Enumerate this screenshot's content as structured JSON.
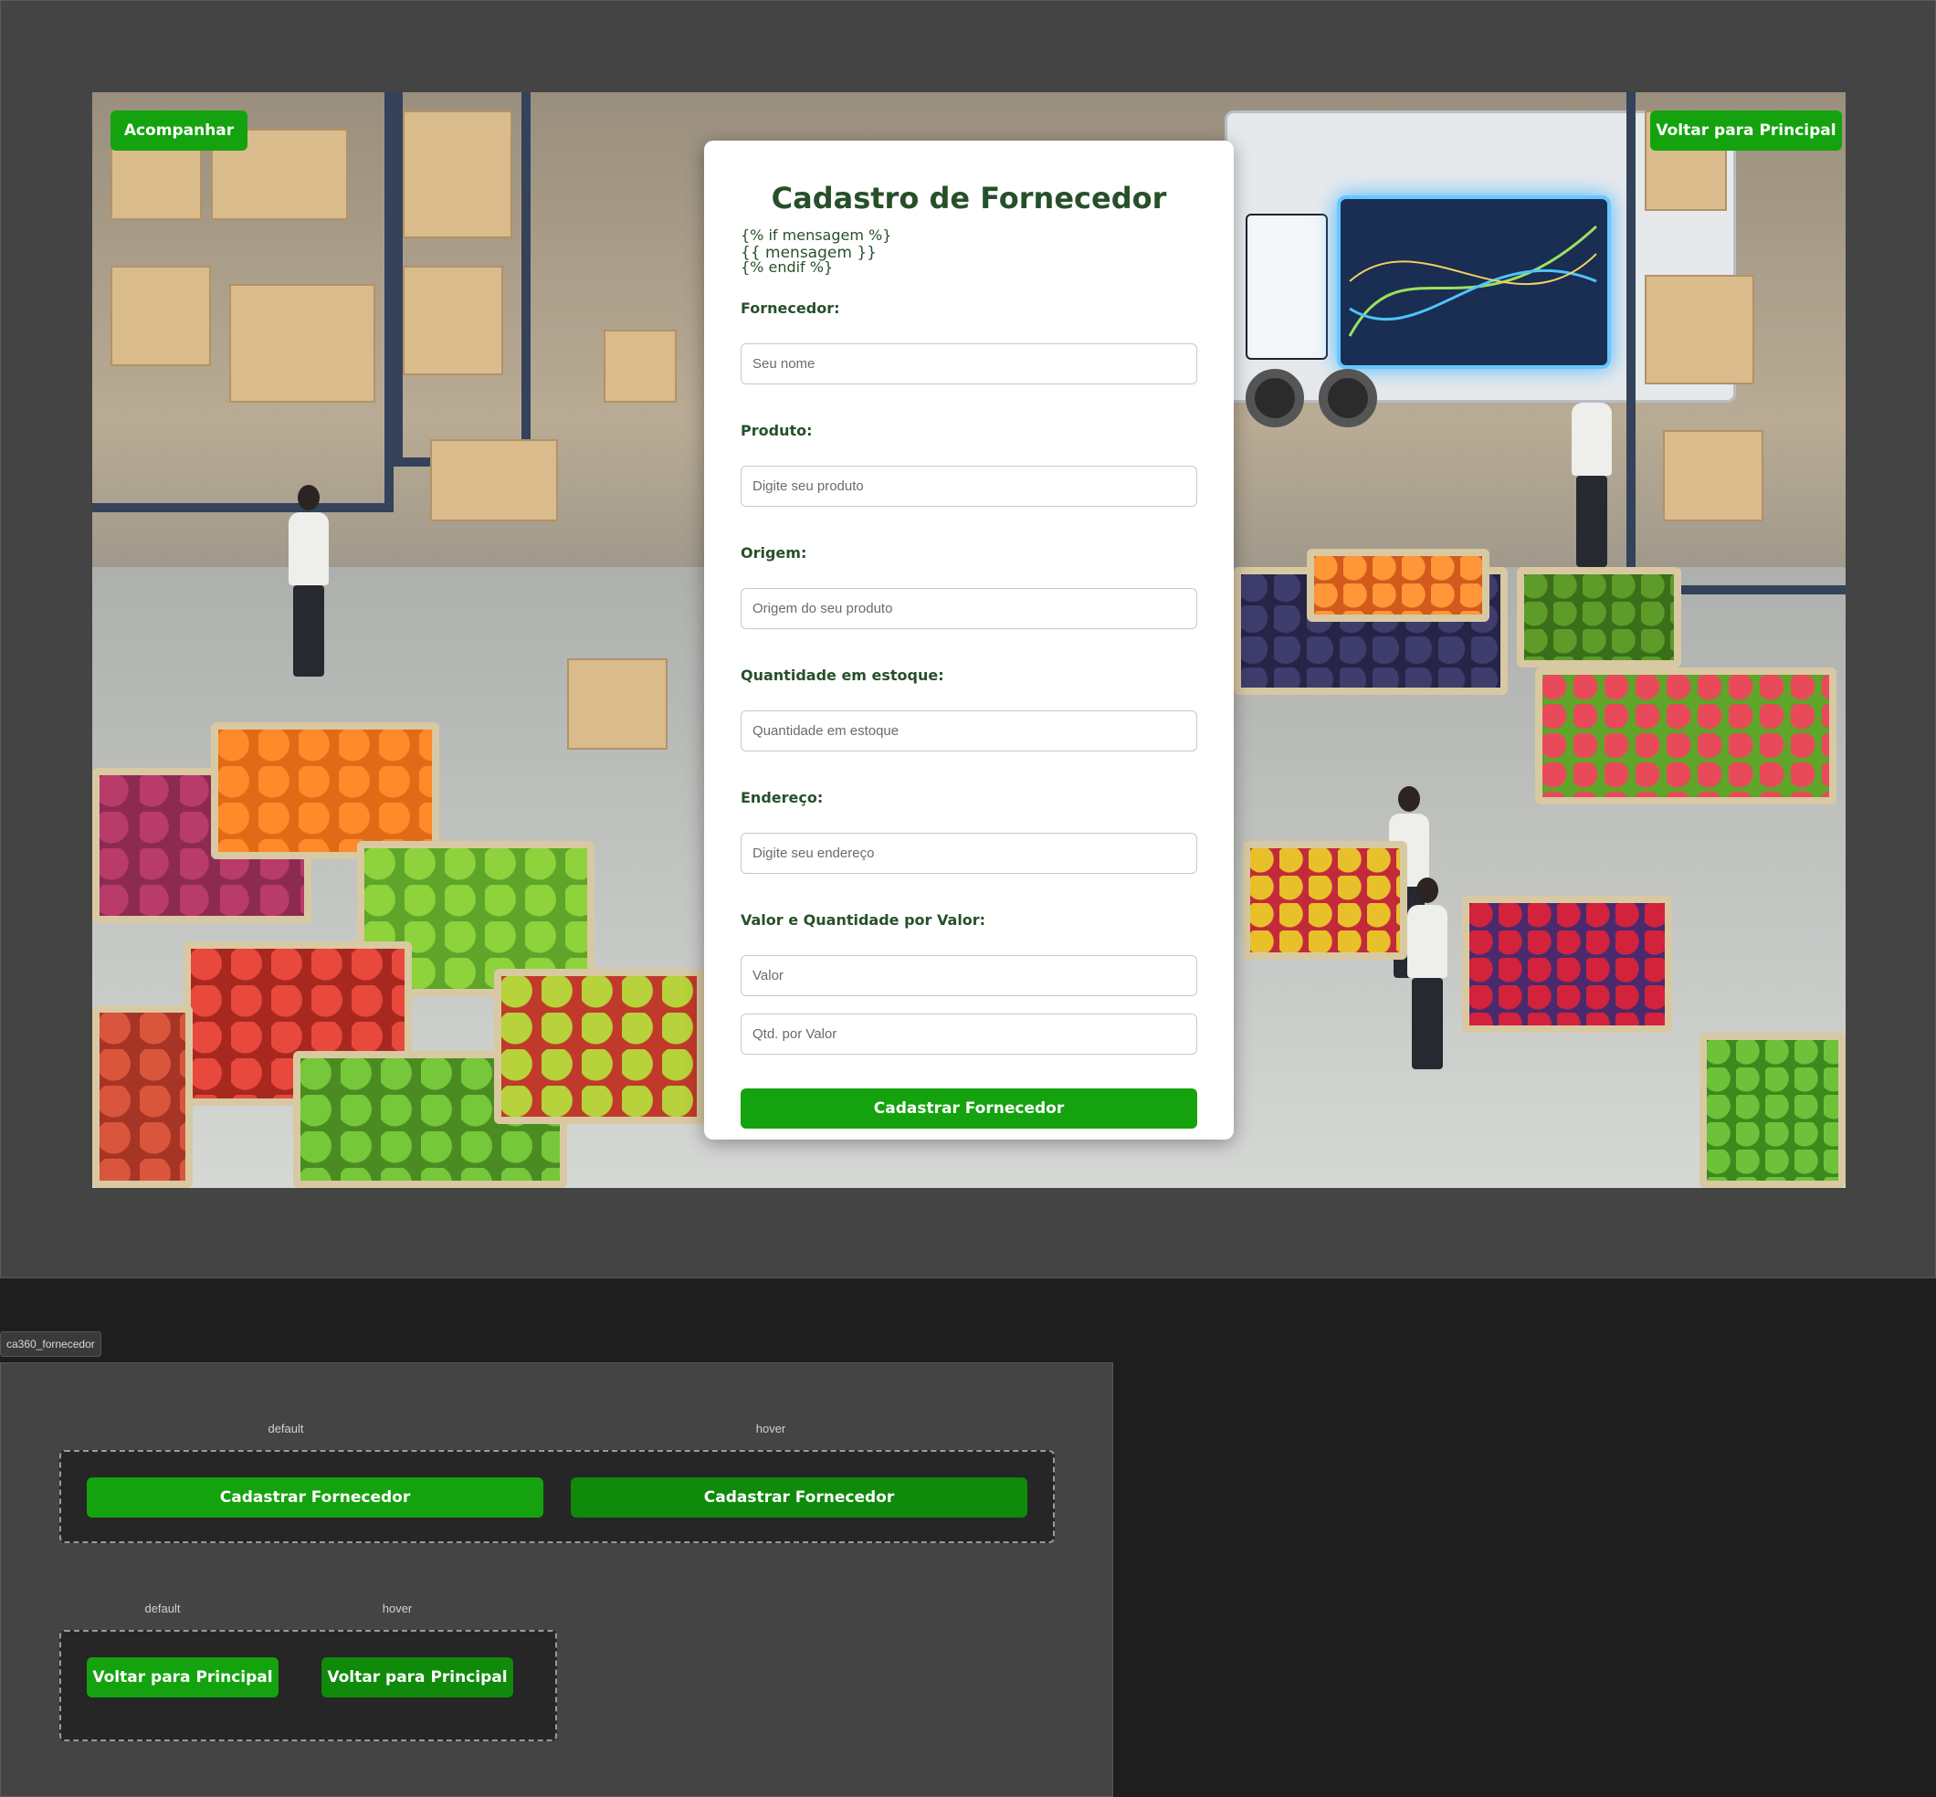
{
  "colors": {
    "primary_button": "#14a30e",
    "primary_button_hover": "#0f8a0b",
    "heading": "#27502a",
    "card_bg": "#ffffff",
    "canvas_bg": "#444444",
    "outer_bg": "#1e1e1e"
  },
  "nav": {
    "track_label": "Acompanhar",
    "back_label": "Voltar para Principal"
  },
  "form": {
    "title": "Cadastro de Fornecedor",
    "template_lines": [
      "{% if mensagem %}",
      "{{ mensagem }}",
      "{% endif %}"
    ],
    "fields": [
      {
        "label": "Fornecedor:",
        "placeholder": "Seu nome"
      },
      {
        "label": "Produto:",
        "placeholder": "Digite seu produto"
      },
      {
        "label": "Origem:",
        "placeholder": "Origem do seu produto"
      },
      {
        "label": "Quantidade em estoque:",
        "placeholder": "Quantidade em estoque"
      },
      {
        "label": "Endereço:",
        "placeholder": "Digite seu endereço"
      }
    ],
    "value_group": {
      "label": "Valor e Quantidade por Valor:",
      "value_placeholder": "Valor",
      "qty_placeholder": "Qtd. por Valor"
    },
    "submit_label": "Cadastrar Fornecedor"
  },
  "component_sheet": {
    "frame_name": "ca360_fornecedor",
    "submit_states": [
      {
        "state": "default",
        "label": "Cadastrar Fornecedor"
      },
      {
        "state": "hover",
        "label": "Cadastrar Fornecedor"
      }
    ],
    "back_states": [
      {
        "state": "default",
        "label": "Voltar para Principal"
      },
      {
        "state": "hover",
        "label": "Voltar para Principal"
      }
    ]
  }
}
